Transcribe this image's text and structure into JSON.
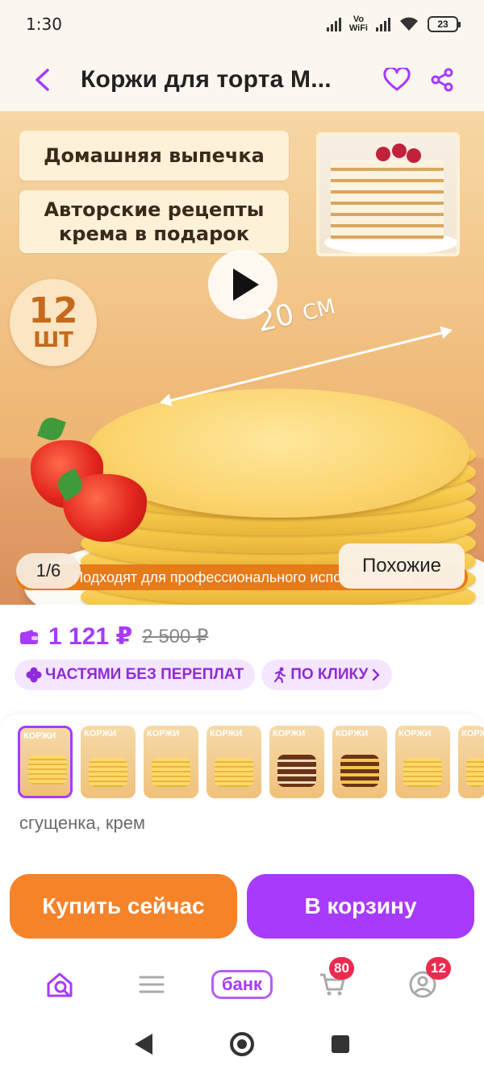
{
  "status_bar": {
    "time": "1:30",
    "vowifi_top": "Vo",
    "vowifi_bottom": "WiFi",
    "battery": "23"
  },
  "header": {
    "title": "Коржи для торта М..."
  },
  "hero": {
    "promo_1": "Домашняя выпечка",
    "promo_2_line1": "Авторские рецепты",
    "promo_2_line2": "крема в подарок",
    "qty_number": "12",
    "qty_unit": "ШТ",
    "measure_value": "20",
    "measure_unit": "СМ",
    "banner_text": "Подходят для профессионального использования",
    "counter": "1/6",
    "similar_label": "Похожие"
  },
  "price": {
    "current": "1 121 ₽",
    "old": "2 500 ₽",
    "tag_installments": "ЧАСТЯМИ БЕЗ ПЕРЕПЛАТ",
    "tag_oneclick": "ПО КЛИКУ"
  },
  "variants": {
    "items": [
      {
        "title": "КОРЖИ"
      },
      {
        "title": "КОРЖИ"
      },
      {
        "title": "КОРЖИ"
      },
      {
        "title": "КОРЖИ"
      },
      {
        "title": "КОРЖИ"
      },
      {
        "title": "КОРЖИ"
      },
      {
        "title": "КОРЖИ"
      },
      {
        "title": "КОРЖИ"
      }
    ],
    "description": "сгущенка, крем"
  },
  "cta": {
    "buy_now": "Купить сейчас",
    "add_to_cart": "В корзину"
  },
  "bottom_nav": {
    "bank_label": "банк",
    "cart_badge": "80",
    "profile_badge": "12"
  },
  "colors": {
    "accent": "#a73afd",
    "buy": "#f5832a",
    "badge": "#ee2a4f"
  }
}
